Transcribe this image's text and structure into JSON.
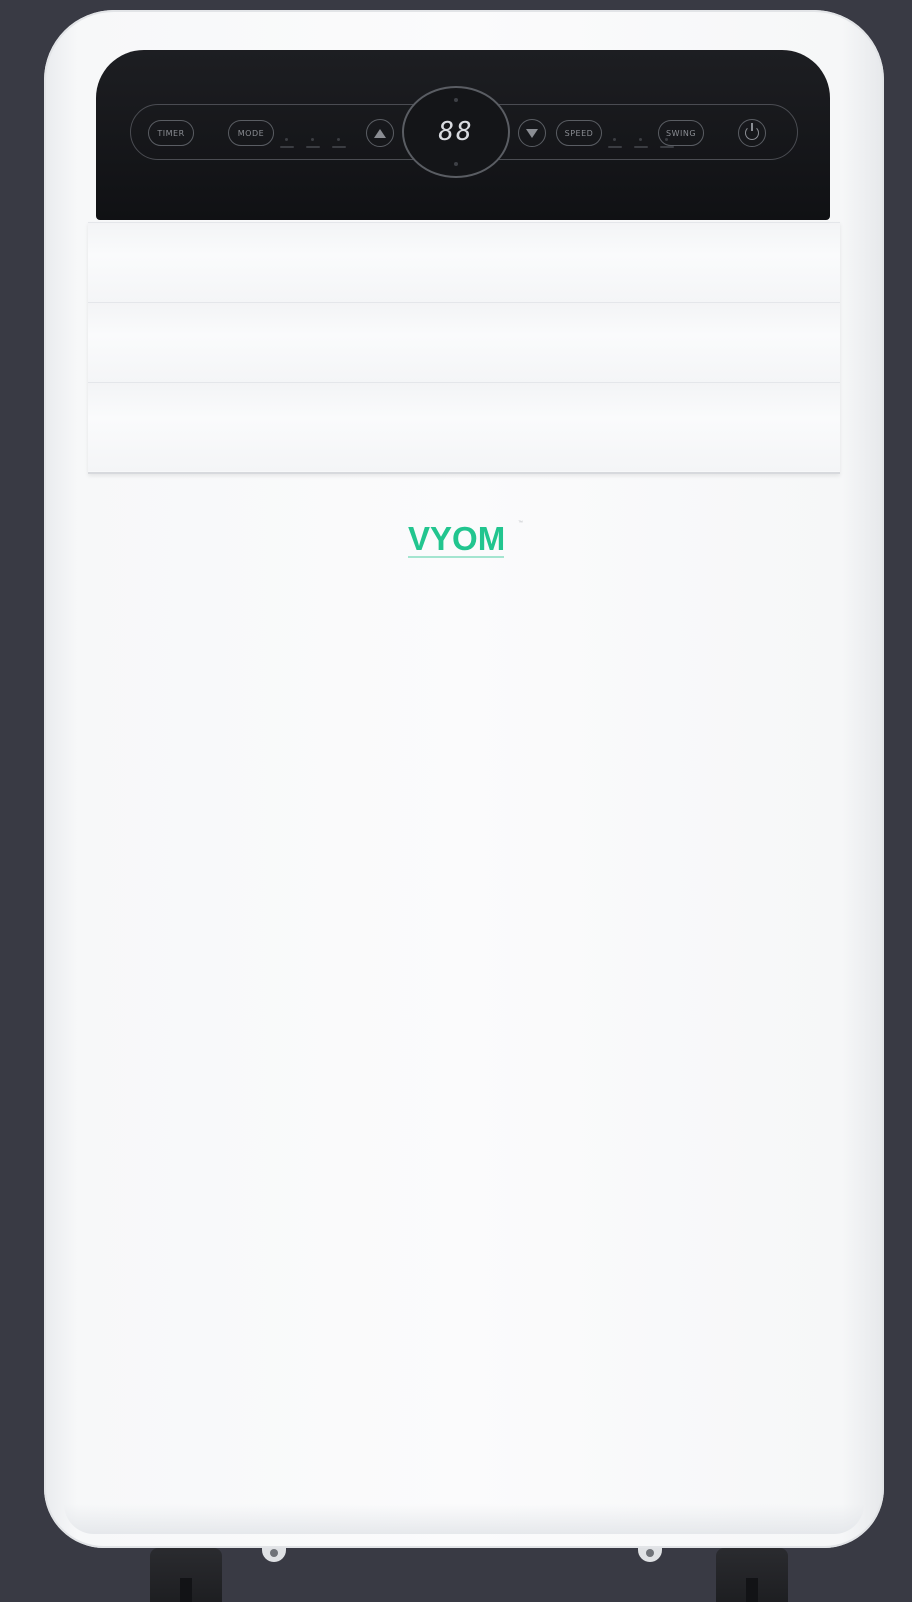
{
  "product": {
    "brand": "VYOM",
    "brand_mark": "™",
    "brand_color": "#22c58f",
    "body_color": "#fbfbfc",
    "background_color": "#393a44"
  },
  "control_panel": {
    "display_value": "88",
    "buttons": {
      "timer": "TIMER",
      "mode": "MODE",
      "temp_up_icon": "triangle-up-icon",
      "temp_down_icon": "triangle-down-icon",
      "speed": "SPEED",
      "swing": "SWING",
      "power_icon": "power-icon"
    }
  }
}
